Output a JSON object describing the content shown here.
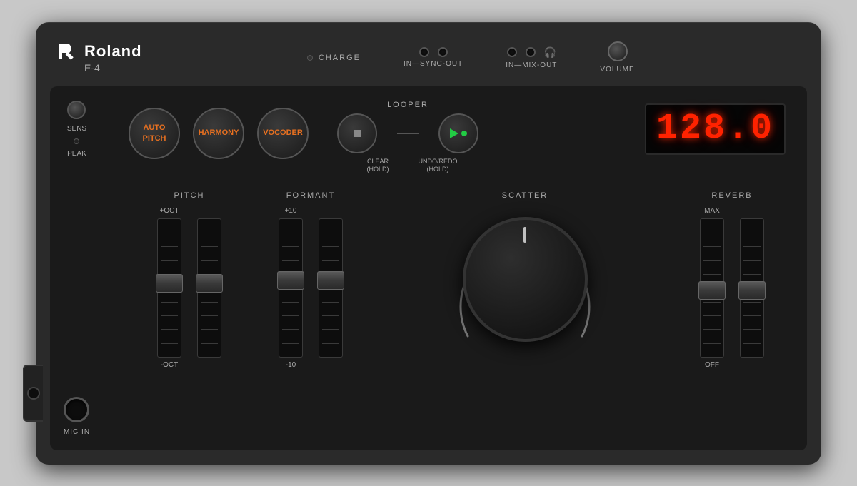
{
  "brand": {
    "logo_text": "Roland",
    "model": "E-4"
  },
  "header": {
    "charge_label": "CHARGE",
    "sync_ports_label": "IN—SYNC-OUT",
    "mix_ports_label": "IN—MIX-OUT",
    "volume_label": "VOLUME"
  },
  "left_panel": {
    "sens_label": "SENS",
    "peak_label": "PEAK",
    "mic_in_label": "MIC IN"
  },
  "effects": {
    "auto_pitch_label": "AUTO\nPITCH",
    "harmony_label": "HARMONY",
    "vocoder_label": "VOCODER"
  },
  "looper": {
    "title": "LOOPER",
    "clear_label": "CLEAR\n(HOLD)",
    "undo_redo_label": "UNDO/REDO\n(HOLD)"
  },
  "display": {
    "value": "128.0"
  },
  "pitch": {
    "title": "PITCH",
    "top_label": "+OCT",
    "bottom_label": "-OCT"
  },
  "formant": {
    "title": "FORMANT",
    "top_label": "+10",
    "bottom_label": "-10"
  },
  "scatter": {
    "title": "SCATTER"
  },
  "reverb": {
    "title": "REVERB",
    "top_label": "MAX",
    "bottom_label": "OFF"
  }
}
